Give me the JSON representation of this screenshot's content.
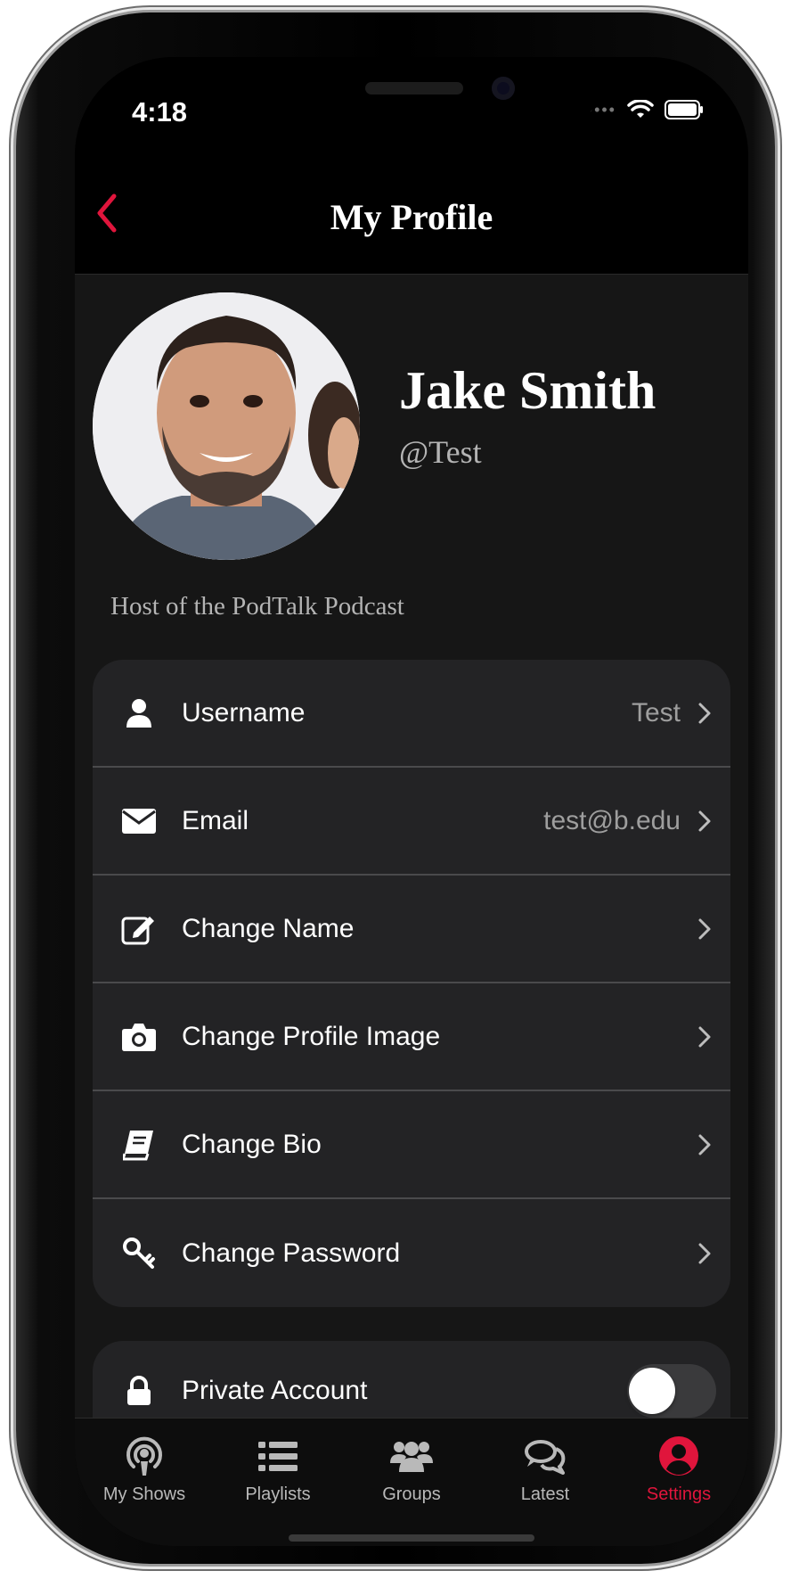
{
  "status": {
    "time": "4:18"
  },
  "nav": {
    "title": "My Profile"
  },
  "profile": {
    "name": "Jake Smith",
    "handle": "@Test",
    "bio": "Host of the PodTalk Podcast"
  },
  "settings": [
    {
      "icon": "user-icon",
      "label": "Username",
      "value": "Test"
    },
    {
      "icon": "envelope-icon",
      "label": "Email",
      "value": "test@b.edu"
    },
    {
      "icon": "edit-icon",
      "label": "Change Name",
      "value": ""
    },
    {
      "icon": "camera-icon",
      "label": "Change Profile Image",
      "value": ""
    },
    {
      "icon": "book-icon",
      "label": "Change Bio",
      "value": ""
    },
    {
      "icon": "key-icon",
      "label": "Change Password",
      "value": ""
    }
  ],
  "privacy": {
    "icon": "lock-icon",
    "label": "Private Account",
    "enabled": false
  },
  "tabs": [
    {
      "icon": "podcast-icon",
      "label": "My Shows",
      "active": false
    },
    {
      "icon": "list-icon",
      "label": "Playlists",
      "active": false
    },
    {
      "icon": "users-icon",
      "label": "Groups",
      "active": false
    },
    {
      "icon": "comments-icon",
      "label": "Latest",
      "active": false
    },
    {
      "icon": "user-circle-icon",
      "label": "Settings",
      "active": true
    }
  ],
  "colors": {
    "accent": "#e0153c",
    "background": "#161616",
    "card": "#232325",
    "text": "#ffffff",
    "muted": "#9e9e9e"
  }
}
